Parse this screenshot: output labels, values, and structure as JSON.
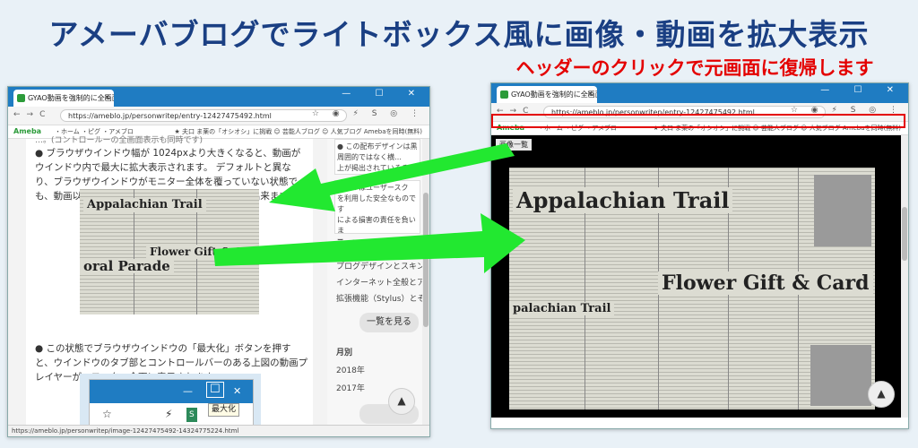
{
  "headline": "アメーバブログでライトボックス風に画像・動画を拡大表示",
  "subhead": "ヘッダーのクリックで元画面に復帰します",
  "browser": {
    "tab_title": "GYAO動画を強制的に全画面表示させ…",
    "tab_close": "×",
    "window_controls": "—  ☐  ✕",
    "nav_buttons": "←→C",
    "url": "https://ameblo.jp/personwritep/entry-12427475492.html",
    "toolbar_icons": "☆ ◉ ⚡ S ◎ ⋮"
  },
  "ameba_bar": {
    "logo": "Ameba",
    "nav": "・ホーム ・ピグ ・アメブロ",
    "right": "★ 夫口 ま薬の「オシオシ」に挑戦  ☺ 芸能人ブログ  ☺ 人気ブログ   Amebaを同時(無料)"
  },
  "left_article": {
    "top_line": "…。(コントロールーの全画面表示も同時です)",
    "para1": "● ブラウザウインドウ幅が 1024pxより大きくなると、動画がウインドウ内で最大に拡大表示されます。 デフォルトと異なり、ブラウザウインドウがモニター全体を覆っていない状態でも、動画以外を表示しない動画プレイヤーの状態に出来ます。",
    "para2": "● この状態でブラウザウインドウの「最大化」ボタンを押すと、ウインドウのタブ部とコントロールバーのある上図の動画プレイヤーが、モニター全面に表示されます。"
  },
  "left_sidebar": {
    "box1": "● この配布デザインは黒\n周囲的ではなく横…\n上が掲出されているぞ…",
    "box2": "ツールはユーザースク\nを利用した安全なものです\nによる損害の責任を負いま\nもとでご利用下さい。",
    "heading": "テーマ",
    "items": [
      "プログデザインとスキン編集",
      "インターネット全般とアプリ",
      "拡張機能（Stylus）とそのス"
    ],
    "more_button": "一覧を見る",
    "month_heading": "月別",
    "years": [
      "2018年",
      "2017年"
    ]
  },
  "newspaper": {
    "title": "Appalachian Trail",
    "banner": "Flower Gift & Card",
    "parade": "oral Parade",
    "sub": "palachian Trail"
  },
  "maximize_demo": {
    "minimize": "—",
    "maximize": "☐",
    "close": "✕",
    "tooltip": "最大化",
    "star": "☆",
    "bolt": "⚡",
    "s_icon": "S"
  },
  "right_view": {
    "list_button": "画像一覧"
  },
  "status_url": "https://ameblo.jp/personwritep/image-12427475492-14324775224.html",
  "up_button": "▲"
}
